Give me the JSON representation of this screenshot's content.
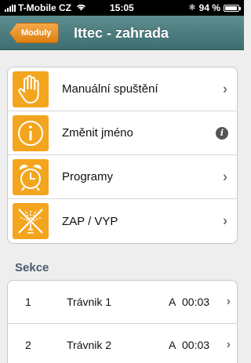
{
  "status_bar": {
    "carrier": "T-Mobile CZ",
    "time": "15:05",
    "battery_label": "94 %",
    "battery_level": 0.94
  },
  "nav": {
    "back_label": "Moduly",
    "title": "Ittec - zahrada"
  },
  "menu": [
    {
      "label": "Manuální spuštění",
      "icon": "hand-icon",
      "accessory": "chevron"
    },
    {
      "label": "Změnit jméno",
      "icon": "info-circle-icon",
      "accessory": "info"
    },
    {
      "label": "Programy",
      "icon": "alarm-clock-icon",
      "accessory": "chevron"
    },
    {
      "label": "ZAP / VYP",
      "icon": "sprinkler-off-icon",
      "accessory": "chevron"
    }
  ],
  "sections": {
    "header": "Sekce",
    "rows": [
      {
        "number": "1",
        "name": "Trávnik 1",
        "program": "A",
        "duration": "00:03"
      },
      {
        "number": "2",
        "name": "Trávnik 2",
        "program": "A",
        "duration": "00:03"
      }
    ]
  },
  "colors": {
    "nav_bar": "#4f7f81",
    "accent_orange": "#f4a51e",
    "section_header": "#4a5a6e"
  }
}
